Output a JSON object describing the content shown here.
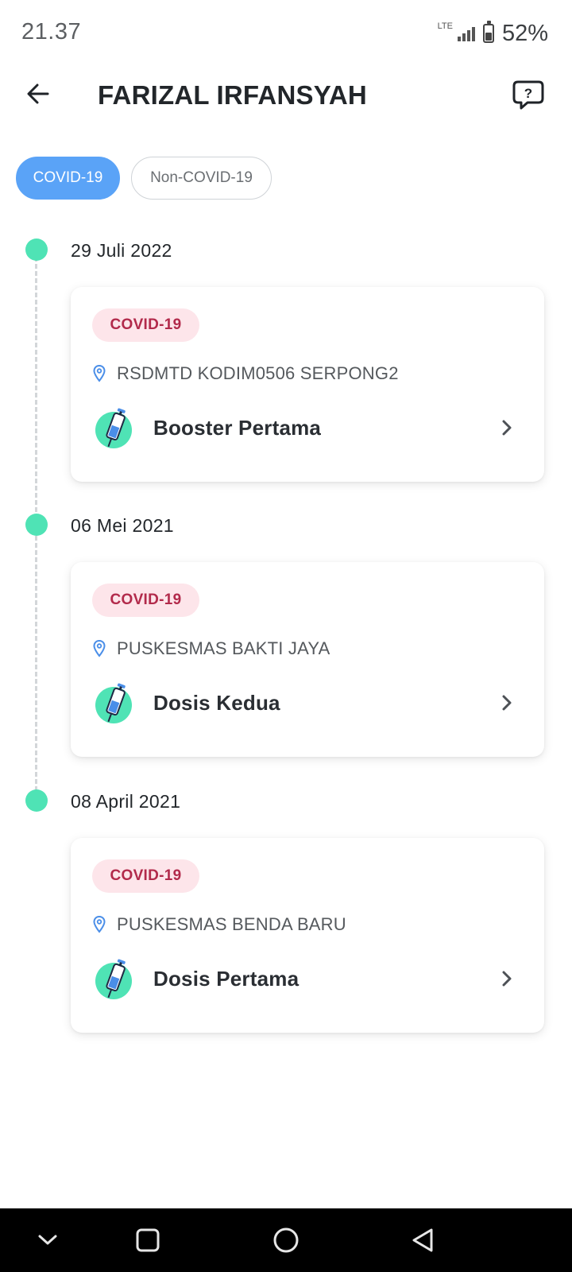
{
  "status_bar": {
    "time": "21.37",
    "network": "LTE",
    "battery": "52%",
    "battery_level": 0.52
  },
  "header": {
    "title": "FARIZAL IRFANSYAH",
    "back_icon": "arrow-left-icon",
    "help_icon": "help-chat-icon"
  },
  "tabs": [
    {
      "label": "COVID-19",
      "active": true
    },
    {
      "label": "Non-COVID-19",
      "active": false
    }
  ],
  "colors": {
    "accent": "#5aa3f7",
    "timeline_dot": "#4fe3b5",
    "badge_bg": "#fde5ea",
    "badge_text": "#b22a4b"
  },
  "records": [
    {
      "date": "29 Juli 2022",
      "badge": "COVID-19",
      "location": "RSDMTD KODIM0506 SERPONG2",
      "dose": "Booster Pertama"
    },
    {
      "date": "06 Mei 2021",
      "badge": "COVID-19",
      "location": "PUSKESMAS BAKTI JAYA",
      "dose": "Dosis Kedua"
    },
    {
      "date": "08 April 2021",
      "badge": "COVID-19",
      "location": "PUSKESMAS BENDA BARU",
      "dose": "Dosis Pertama"
    }
  ],
  "nav": [
    "chevron-down-icon",
    "recent-apps-icon",
    "home-icon",
    "back-triangle-icon"
  ]
}
